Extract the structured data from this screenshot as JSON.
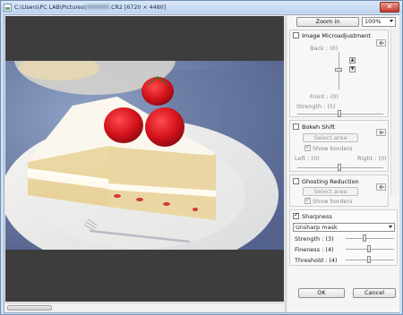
{
  "window": {
    "title": "C:\\Users\\PC LAB\\Pictures\\",
    "title_suffix": ".CR2 [6720 × 4480]",
    "close": "✕"
  },
  "toolbar": {
    "zoom_in_label": "Zoom in",
    "zoom_value": "100%"
  },
  "image_microadjustment": {
    "label": "Image Microadjustment",
    "back_label": "Back : (0)",
    "front_label": "Front : (0)",
    "strength_label": "Strength : (5)"
  },
  "bokeh_shift": {
    "label": "Bokeh Shift",
    "select_area_label": "Select area",
    "show_borders_label": "Show borders",
    "left_label": "Left : (0)",
    "right_label": "Right : (0)"
  },
  "ghosting_reduction": {
    "label": "Ghosting Reduction",
    "select_area_label": "Select area",
    "show_borders_label": "Show borders"
  },
  "sharpness": {
    "label": "Sharpness",
    "mode_value": "Unsharp mask",
    "strength_label": "Strength : (3)",
    "fineness_label": "Fineness : (4)",
    "threshold_label": "Threshold : (4)"
  },
  "footer": {
    "ok_label": "OK",
    "cancel_label": "Cancel"
  }
}
